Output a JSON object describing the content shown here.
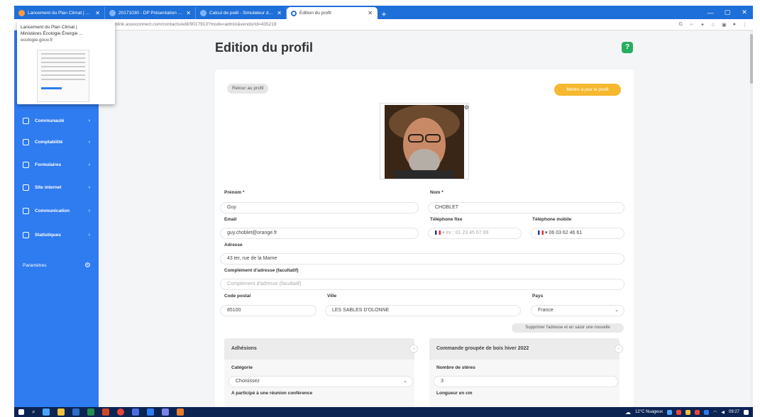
{
  "browser": {
    "tabs": [
      {
        "title": "Lancement du Plan Climat | Mini"
      },
      {
        "title": "20171030 - DP Présentation P..."
      },
      {
        "title": "Calcul de poêl - Simulateur des ..."
      },
      {
        "title": "Édition du profil"
      }
    ],
    "url": "mlink.assoconnect.com/contacts/edit/9017913?mode=admin&vendorId=435219",
    "new_tab": "+",
    "win_min": "—",
    "win_max": "▢",
    "win_close": "✕"
  },
  "tooltip": {
    "title": "Lancement du Plan Climat |",
    "subtitle": "Ministères Écologie Énergie ...",
    "domain": "ecologie.gouv.fr"
  },
  "sidebar": {
    "items": [
      {
        "label": "Communauté",
        "icon": "community-icon"
      },
      {
        "label": "Comptabilité",
        "icon": "accounting-icon"
      },
      {
        "label": "Formulaires",
        "icon": "forms-icon"
      },
      {
        "label": "Site internet",
        "icon": "website-icon"
      },
      {
        "label": "Communication",
        "icon": "communication-icon"
      },
      {
        "label": "Statistiques",
        "icon": "stats-icon"
      }
    ],
    "settings_label": "Paramètres"
  },
  "page": {
    "title": "Edition du profil",
    "help": "?",
    "back_button": "Retour au profil",
    "update_button": "Mettre à jour le profil"
  },
  "form": {
    "prenom_label": "Prénom *",
    "prenom_value": "Guy",
    "nom_label": "Nom *",
    "nom_value": "CHOBLET",
    "email_label": "Email",
    "email_value": "guy.choblet@orange.fr",
    "tel_fixe_label": "Téléphone fixe",
    "tel_fixe_placeholder": "ex : 01 23 45 67 89",
    "tel_mobile_label": "Téléphone mobile",
    "tel_mobile_value": "06 03 62 46 61",
    "adresse_label": "Adresse",
    "adresse_value": "43 ter, rue de la Marne",
    "complement_label": "Complément d'adresse (facultatif)",
    "complement_placeholder": "Complément d'adresse (facultatif)",
    "cp_label": "Code postal",
    "cp_value": "85100",
    "ville_label": "Ville",
    "ville_value": "LES SABLES D'OLONNE",
    "pays_label": "Pays",
    "pays_value": "France",
    "remove_address_button": "Supprimer l'adresse et en saisir une nouvelle"
  },
  "adhesions": {
    "title": "Adhésions",
    "categorie_label": "Catégorie",
    "categorie_value": "Choisissez",
    "conference_label": "A participé à une réunion conférence"
  },
  "commande": {
    "title": "Commande groupée de bois hiver 2022",
    "steres_label": "Nombre de stères",
    "steres_value": "3",
    "longueur_label": "Longueur en cm"
  },
  "taskbar": {
    "weather": "12°C Nuageux",
    "time": "09:27"
  }
}
